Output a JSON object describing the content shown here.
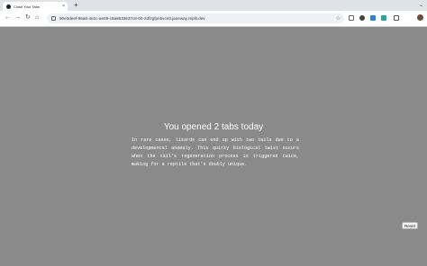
{
  "browser": {
    "tab_title": "Close Your Tabs",
    "tab_close": "×",
    "new_tab": "+",
    "window_control": "⌄",
    "nav": {
      "back": "←",
      "forward": "→",
      "reload": "↻",
      "home": "⌂"
    },
    "url": "90e3deef-96a8-4e2c-ae09-c8a8633637c8-00-2dfzgfpnbvcn0.janeway.replit.dev",
    "star": "☆"
  },
  "page": {
    "heading": "You opened 2 tabs today",
    "fact": "In rare cases, lizards can end up with two tails due to a developmental anomaly. This quirky biological twist occurs when the tail's regeneration process is triggered twice, making for a reptile that's doubly unique.",
    "reset_label": "Reset"
  },
  "colors": {
    "background": "#8a8a8a",
    "text": "#ffffff"
  }
}
